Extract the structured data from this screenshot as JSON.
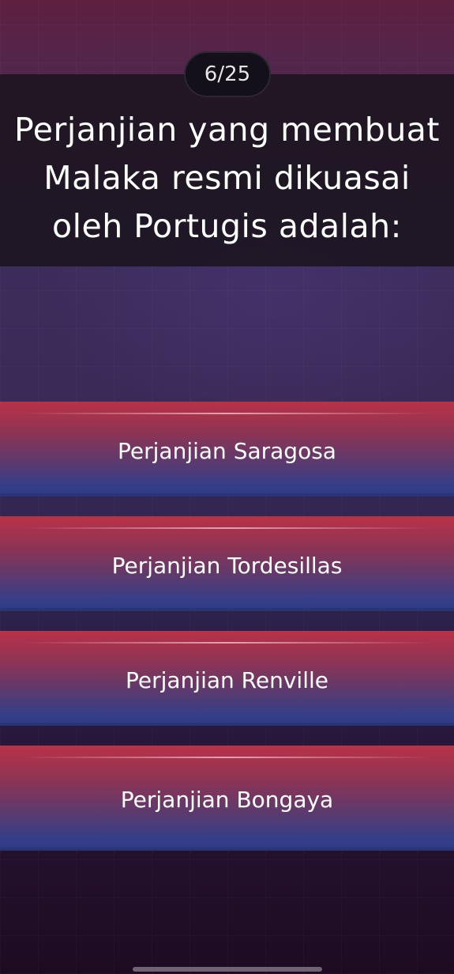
{
  "quiz": {
    "progress": "6/25",
    "question_lines": [
      "Perjanjian yang membuat",
      "Malaka resmi dikuasai",
      "oleh Portugis adalah:"
    ],
    "answers": [
      {
        "label": "Perjanjian Saragosa"
      },
      {
        "label": "Perjanjian Tordesillas"
      },
      {
        "label": "Perjanjian Renville"
      },
      {
        "label": "Perjanjian Bongaya"
      }
    ]
  },
  "colors": {
    "answer_top": "#b93247",
    "answer_bottom": "#2f3b86",
    "panel": "#18121a",
    "background_top": "#5e2040",
    "background_bottom": "#1d0b22"
  }
}
